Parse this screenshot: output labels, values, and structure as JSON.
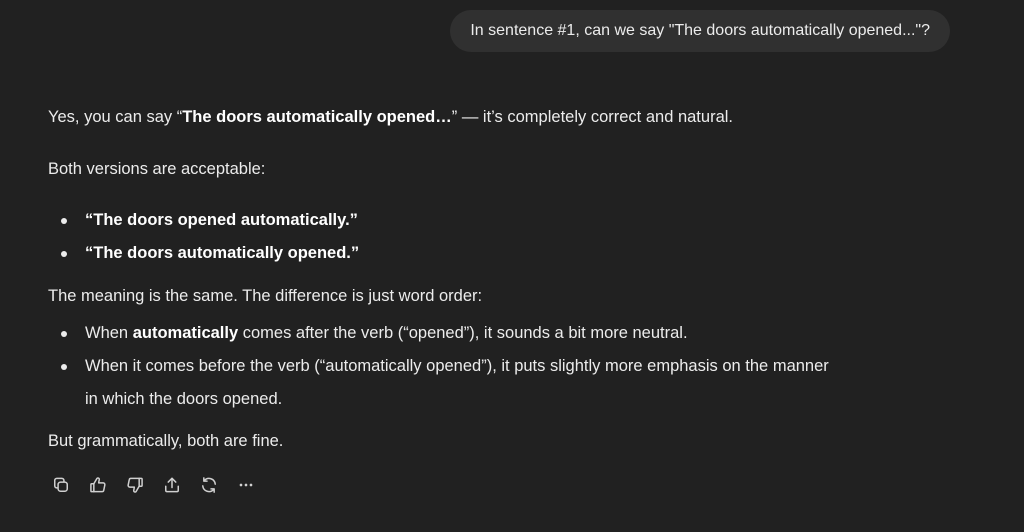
{
  "user_message": "In sentence #1, can we say \"The doors automatically opened...\"?",
  "response": {
    "p1": {
      "pre": "Yes, you can say “",
      "bold": "The doors automatically opened…",
      "post": "” — it’s completely correct and natural."
    },
    "p2": "Both versions are acceptable:",
    "versions": [
      "“The doors opened automatically.”",
      "“The doors automatically opened.”"
    ],
    "p3": "The meaning is the same. The difference is just word order:",
    "points": {
      "first": {
        "pre": "When ",
        "bold": "automatically",
        "post": " comes after the verb (“opened”), it sounds a bit more neutral."
      },
      "second": {
        "line1": "When it comes before the verb (“automatically opened”), it puts slightly more emphasis on the manner",
        "line2": "in which the doors opened."
      }
    },
    "p4": "But grammatically, both are fine."
  },
  "actions": [
    {
      "icon": "copy-icon"
    },
    {
      "icon": "thumbs-up-icon"
    },
    {
      "icon": "thumbs-down-icon"
    },
    {
      "icon": "share-icon"
    },
    {
      "icon": "regenerate-icon"
    },
    {
      "icon": "more-icon"
    }
  ],
  "colors": {
    "background": "#212121",
    "bubble": "#303030",
    "text": "#ececec",
    "bold": "#ffffff"
  }
}
